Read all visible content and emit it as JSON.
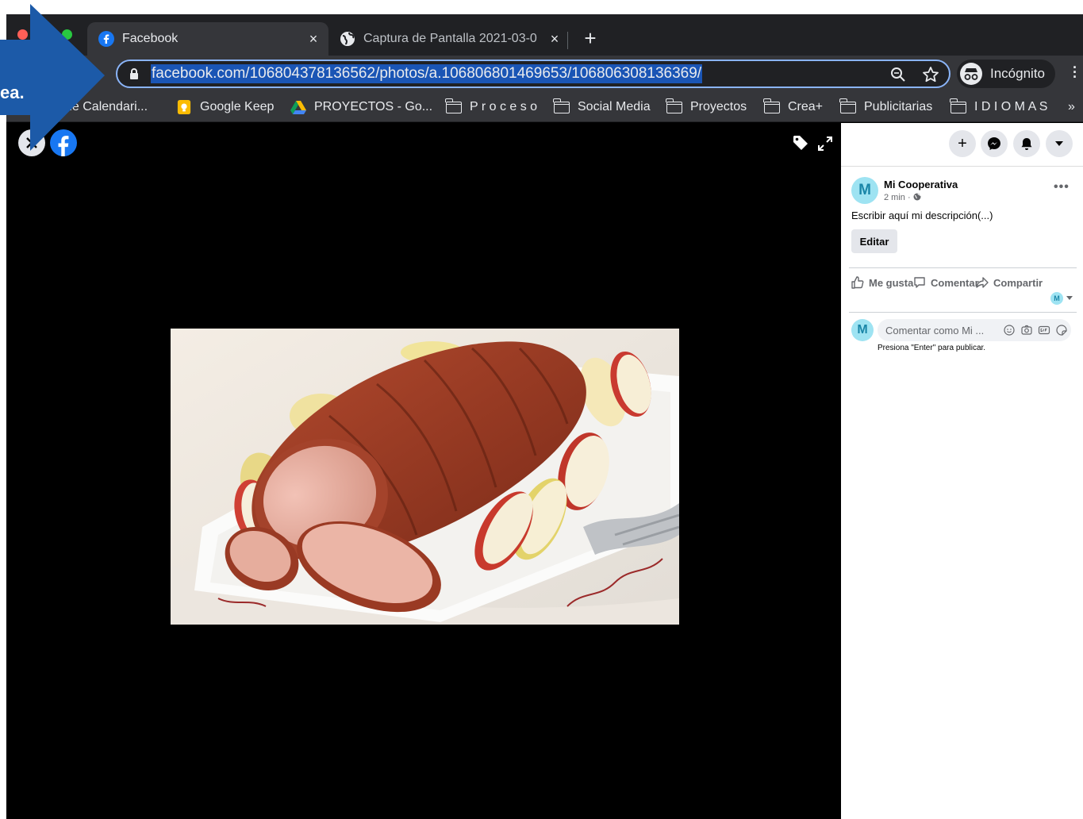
{
  "browser": {
    "tabs": [
      {
        "title": "Facebook",
        "close": "×"
      },
      {
        "title": "Captura de Pantalla 2021-03-0",
        "close": "×"
      }
    ],
    "new_tab": "+",
    "address": "facebook.com/106804378136562/photos/a.106806801469653/106806308136369/",
    "incognito_label": "Incógnito",
    "bookmarks": [
      {
        "label": "...le Calendari...",
        "icon": "calendar-icon"
      },
      {
        "label": "Google Keep",
        "icon": "keep-icon"
      },
      {
        "label": "PROYECTOS - Go...",
        "icon": "drive-icon"
      },
      {
        "label": "P r o c e s o",
        "icon": "folder-icon"
      },
      {
        "label": "Social Media",
        "icon": "folder-icon"
      },
      {
        "label": "Proyectos",
        "icon": "folder-icon"
      },
      {
        "label": "Crea+",
        "icon": "folder-icon"
      },
      {
        "label": "Publicitarias",
        "icon": "folder-icon"
      },
      {
        "label": "I D I O M A S",
        "icon": "folder-icon"
      }
    ],
    "bookmarks_overflow": "»"
  },
  "overlay": {
    "text": "ea."
  },
  "post": {
    "avatar_letter": "M",
    "author": "Mi Cooperativa",
    "meta": "2 min · ",
    "more": "•••",
    "description": "Escribir aquí mi descripción(...)",
    "edit_label": "Editar",
    "actions": {
      "like": "Me gusta",
      "comment": "Comentar",
      "share": "Compartir"
    },
    "comment_placeholder": "Comentar como Mi ...",
    "hint": "Presiona \"Enter\" para publicar."
  },
  "topbar": {
    "plus": "+"
  },
  "colors": {
    "facebook_blue": "#1877f2",
    "accent": "#8ab4f8",
    "arrow": "#1c5aa8"
  }
}
